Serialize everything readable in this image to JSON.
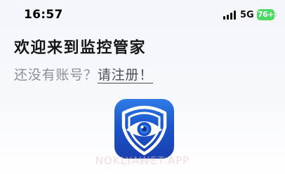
{
  "status_bar": {
    "time": "16:57",
    "network": "5G",
    "battery": "76+",
    "battery_color": "#4cd964"
  },
  "header": {
    "welcome": "欢迎来到监控管家",
    "no_account": "还没有账号？",
    "register_link": "请注册！"
  },
  "logo": {
    "icon": "eye-shield-logo-icon",
    "colors": [
      "#2f7be6",
      "#1a3fae",
      "#ffffff"
    ]
  },
  "watermark": "NOKLYAWET.APP"
}
